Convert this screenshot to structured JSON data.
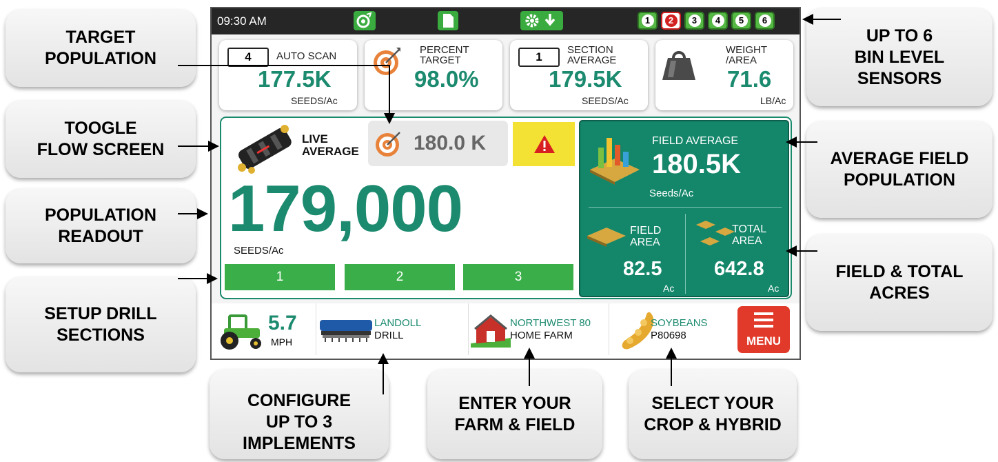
{
  "statusbar": {
    "time": "09:30 AM",
    "bins": [
      "1",
      "2",
      "3",
      "4",
      "5",
      "6"
    ]
  },
  "cards": {
    "autoscan": {
      "count": "4",
      "label": "AUTO SCAN",
      "value": "177.5K",
      "unit": "SEEDS/Ac"
    },
    "percent": {
      "label": "PERCENT\nTARGET",
      "value": "98.0%"
    },
    "section": {
      "count": "1",
      "label": "SECTION\nAVERAGE",
      "value": "179.5K",
      "unit": "SEEDS/Ac"
    },
    "weight": {
      "label": "WEIGHT\n/AREA",
      "value": "71.6",
      "unit": "LB/Ac"
    }
  },
  "main": {
    "live_label": "LIVE\nAVERAGE",
    "target_value": "180.0 K",
    "population": "179,000",
    "population_unit": "SEEDS/Ac",
    "sections": [
      "1",
      "2",
      "3"
    ],
    "field_average": {
      "label": "FIELD AVERAGE",
      "value": "180.5K",
      "unit": "Seeds/Ac"
    },
    "field_area": {
      "label": "FIELD\nAREA",
      "value": "82.5",
      "unit": "Ac"
    },
    "total_area": {
      "label": "TOTAL\nAREA",
      "value": "642.8",
      "unit": "Ac"
    }
  },
  "bottom": {
    "speed": "5.7",
    "speed_unit": "MPH",
    "implement": {
      "line1": "LANDOLL",
      "line2": "DRILL"
    },
    "field": {
      "line1": "NORTHWEST 80",
      "line2": "HOME FARM"
    },
    "crop": {
      "line1": "SOYBEANS",
      "line2": "P80698"
    },
    "menu": "MENU"
  },
  "callouts": {
    "target_population": "TARGET\nPOPULATION",
    "toggle_flow": "TOOGLE\nFLOW SCREEN",
    "population_readout": "POPULATION\nREADOUT",
    "setup_sections": "SETUP DRILL\nSECTIONS",
    "bin_sensors": "UP TO 6\nBIN LEVEL\nSENSORS",
    "avg_field": "AVERAGE FIELD\nPOPULATION",
    "field_total": "FIELD & TOTAL\nACRES",
    "configure": "CONFIGURE\nUP TO 3\nIMPLEMENTS",
    "farm_field": "ENTER YOUR\nFARM & FIELD",
    "crop_hybrid": "SELECT YOUR\nCROP & HYBRID"
  },
  "colors": {
    "accent": "#1b8a6e",
    "panel": "#14876b",
    "section": "#3aaf49",
    "menu": "#e23a2a",
    "warning": "#f3e234"
  }
}
